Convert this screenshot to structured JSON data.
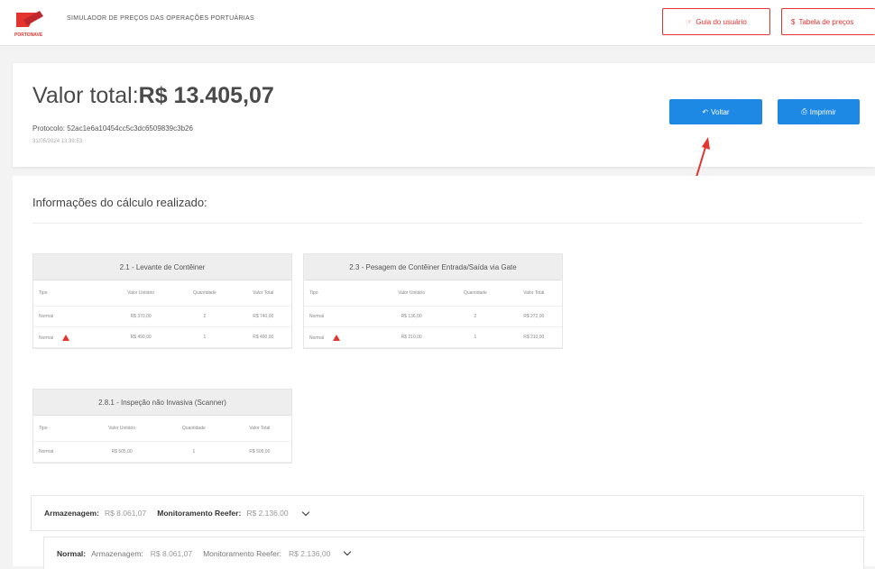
{
  "header": {
    "app_title": "SIMULADOR DE PREÇOS DAS OPERAÇÕES PORTUÁRIAS",
    "logo_text": "PORTONAVE",
    "guide_button": "Guia do usuário",
    "price_table_button": "Tabela de preços"
  },
  "summary": {
    "total_label": "Valor total:",
    "total_value": "R$ 13.405,07",
    "protocol": "Protocolo: 52ac1e6a10454cc5c3dc6509839c3b26",
    "date": "31/05/2024 13:39:53",
    "back_button": "Voltar",
    "print_button": "Imprimir"
  },
  "details": {
    "heading": "Informações do cálculo realizado:",
    "cards": [
      {
        "title": "2.1 - Levante de Contêiner",
        "columns": [
          "Tipo",
          "Valor Unitário",
          "Quantidade",
          "Valor Total"
        ],
        "rows": [
          [
            "Normal",
            "R$ 370,00",
            "2",
            "R$ 740,00"
          ],
          [
            "Normal",
            "R$ 490,00",
            "1",
            "R$ 490,00"
          ]
        ]
      },
      {
        "title": "2.3 - Pesagem de Contêiner Entrada/Saída via Gate",
        "columns": [
          "Tipo",
          "Valor Unitário",
          "Quantidade",
          "Valor Total"
        ],
        "rows": [
          [
            "Normal",
            "R$ 136,00",
            "2",
            "R$ 272,00"
          ],
          [
            "Normal",
            "R$ 210,00",
            "1",
            "R$ 210,00"
          ]
        ]
      },
      {
        "title": "2.8.1 - Inspeção não Invasiva (Scanner)",
        "columns": [
          "Tipo",
          "Valor Unitário",
          "Quantidade",
          "Valor Total"
        ],
        "rows": [
          [
            "Normal",
            "R$ 505,00",
            "1",
            "R$ 505,00"
          ]
        ]
      }
    ],
    "storage": {
      "storage_label": "Armazenagem:",
      "storage_value": "R$ 8.061,07",
      "reefer_label": "Monitoramento Reefer:",
      "reefer_value": "R$ 2.136,00"
    },
    "storage_normal": {
      "type_label": "Normal:",
      "storage_label": "Armazenagem:",
      "storage_value": "R$ 8.061,07",
      "reefer_label": "Monitoramento Reefer:",
      "reefer_value": "R$ 2.136,00"
    }
  },
  "colors": {
    "brand_red": "#e3342f",
    "primary_blue": "#1e88e5"
  },
  "icons": {
    "back": "undo-arrow-icon",
    "print": "printer-icon",
    "guide": "hand-point-icon",
    "price": "dollar-icon",
    "warning": "warning-triangle-icon",
    "expand": "chevron-down-icon"
  }
}
